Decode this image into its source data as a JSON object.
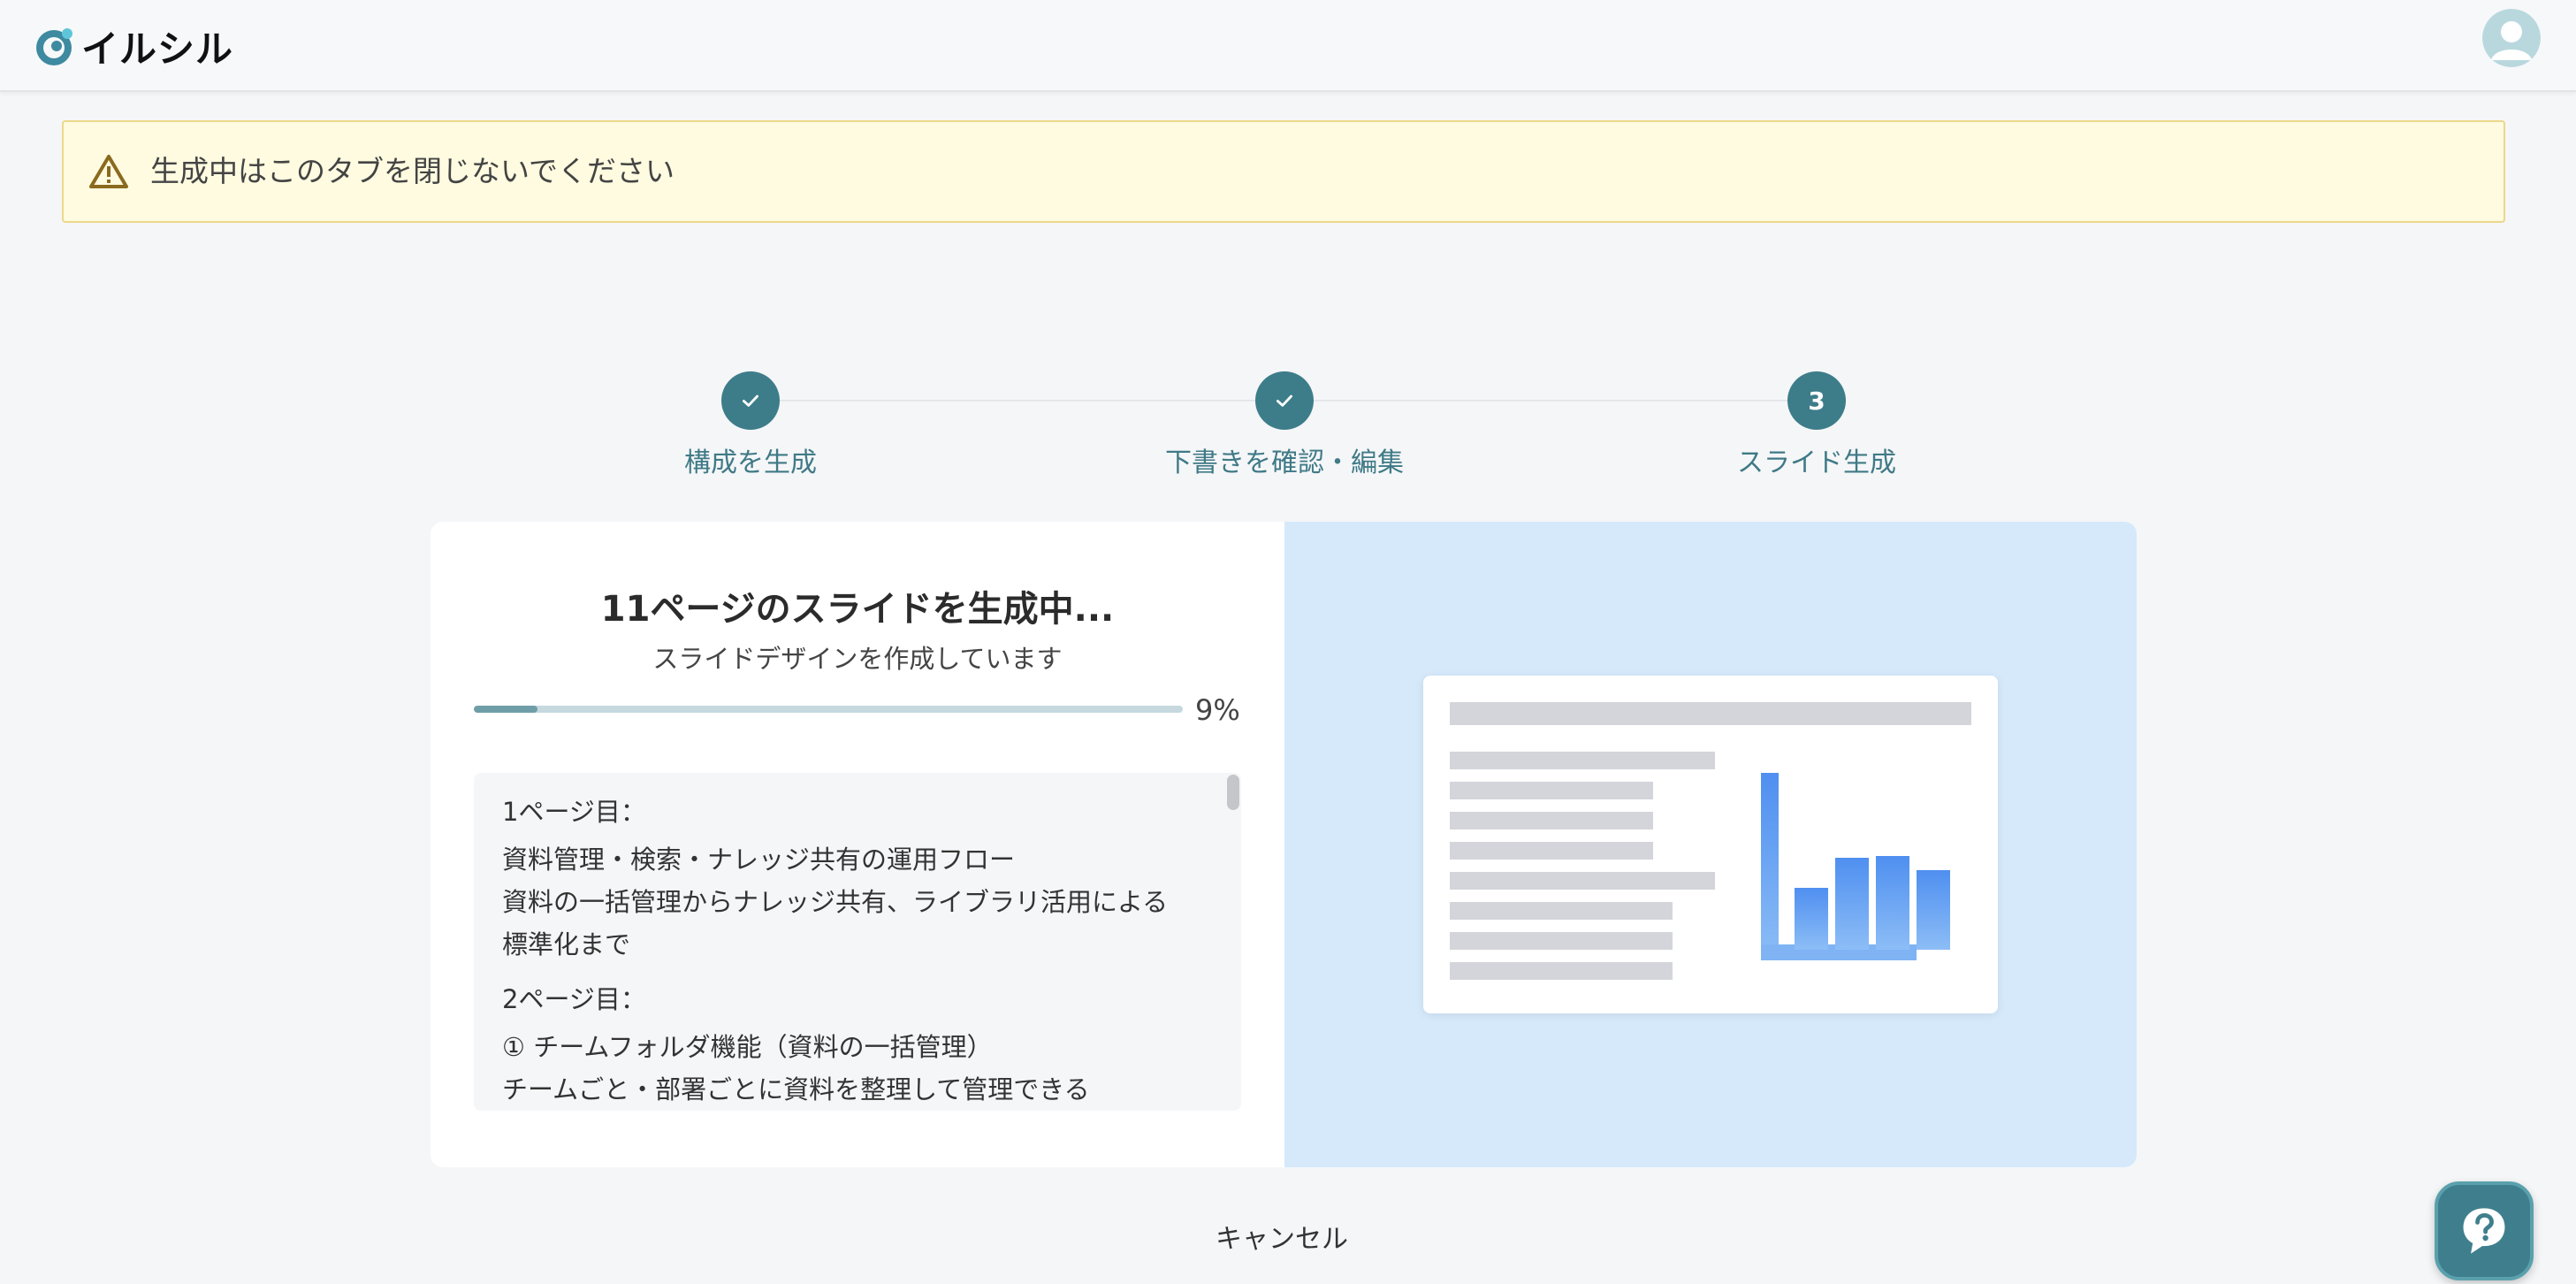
{
  "app": {
    "logo_text": "イルシル"
  },
  "warning": {
    "text": "生成中はこのタブを閉じないでください"
  },
  "steps": [
    {
      "label": "構成を生成",
      "status": "done"
    },
    {
      "label": "下書きを確認・編集",
      "status": "done"
    },
    {
      "label": "スライド生成",
      "status": "current",
      "number": "3"
    }
  ],
  "generation": {
    "title": "11ページのスライドを生成中...",
    "subtitle": "スライドデザインを作成しています",
    "progress_percent": 9,
    "progress_label": "9%"
  },
  "outline": [
    {
      "heading": "1ページ目：",
      "lines": [
        "資料管理・検索・ナレッジ共有の運用フロー",
        "資料の一括管理からナレッジ共有、ライブラリ活用による",
        "標準化まで"
      ]
    },
    {
      "heading": "2ページ目：",
      "lines": [
        "① チームフォルダ機能（資料の一括管理）",
        "チームごと・部署ごとに資料を整理して管理できる"
      ]
    }
  ],
  "actions": {
    "cancel_label": "キャンセル"
  },
  "colors": {
    "accent": "#3d7d8a",
    "warning_bg": "#fefbe0",
    "preview_bg": "#d5e9fb",
    "chart_bar": "#5b9cf2"
  },
  "icons": {
    "logo": "logo-icon",
    "avatar": "user-avatar-icon",
    "warning": "warning-triangle-icon",
    "check": "check-icon",
    "help": "question-mark-icon"
  }
}
